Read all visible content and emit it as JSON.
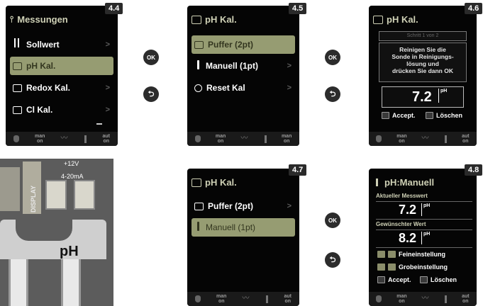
{
  "screens": {
    "s44": {
      "tag": "4.4",
      "title": "Messungen",
      "items": [
        {
          "label": "Sollwert",
          "selected": false
        },
        {
          "label": "pH Kal.",
          "selected": true
        },
        {
          "label": "Redox Kal.",
          "selected": false
        },
        {
          "label": "Cl Kal.",
          "selected": false
        }
      ],
      "status": [
        "man",
        "on",
        "aut",
        "on"
      ]
    },
    "s45": {
      "tag": "4.5",
      "title": "pH Kal.",
      "items": [
        {
          "label": "Puffer (2pt)",
          "selected": true
        },
        {
          "label": "Manuell (1pt)",
          "selected": false
        },
        {
          "label": "Reset Kal",
          "selected": false
        }
      ],
      "status": [
        "man",
        "on",
        "man",
        "on"
      ]
    },
    "s46": {
      "tag": "4.6",
      "title": "pH Kal.",
      "step": "Schritt 1 von 2",
      "instruction": "Reinigen Sie die Sonde in Reinigungs-lösung und drücken Sie dann OK",
      "instruction_lines": [
        "Reinigen Sie die",
        "Sonde in Reinigungs-",
        "lösung und",
        "drücken Sie dann OK"
      ],
      "value": "7.2",
      "unit": "pH",
      "accept_label": "Accept.",
      "delete_label": "Löschen",
      "status": [
        "man",
        "on",
        "aut",
        "on"
      ]
    },
    "s47": {
      "tag": "4.7",
      "title": "pH Kal.",
      "items": [
        {
          "label": "Puffer (2pt)",
          "selected": false
        },
        {
          "label": "Manuell (1pt)",
          "selected": true
        }
      ],
      "status": [
        "man",
        "on",
        "aut",
        "on"
      ]
    },
    "s48": {
      "tag": "4.8",
      "title": "pH:Manuell",
      "current_label": "Aktueller Messwert",
      "current_value": "7.2",
      "desired_label": "Gewünschter Wert",
      "desired_value": "8.2",
      "unit": "pH",
      "fine_label": "Feineinstellung",
      "coarse_label": "Grobeinstellung",
      "accept_label": "Accept.",
      "delete_label": "Löschen",
      "status": [
        "man",
        "on",
        "aut",
        "on"
      ]
    }
  },
  "buttons": {
    "ok": "OK"
  },
  "photo": {
    "voltage": "+12V",
    "current": "4-20mA",
    "display": "DISPLAY",
    "ph": "pH"
  }
}
